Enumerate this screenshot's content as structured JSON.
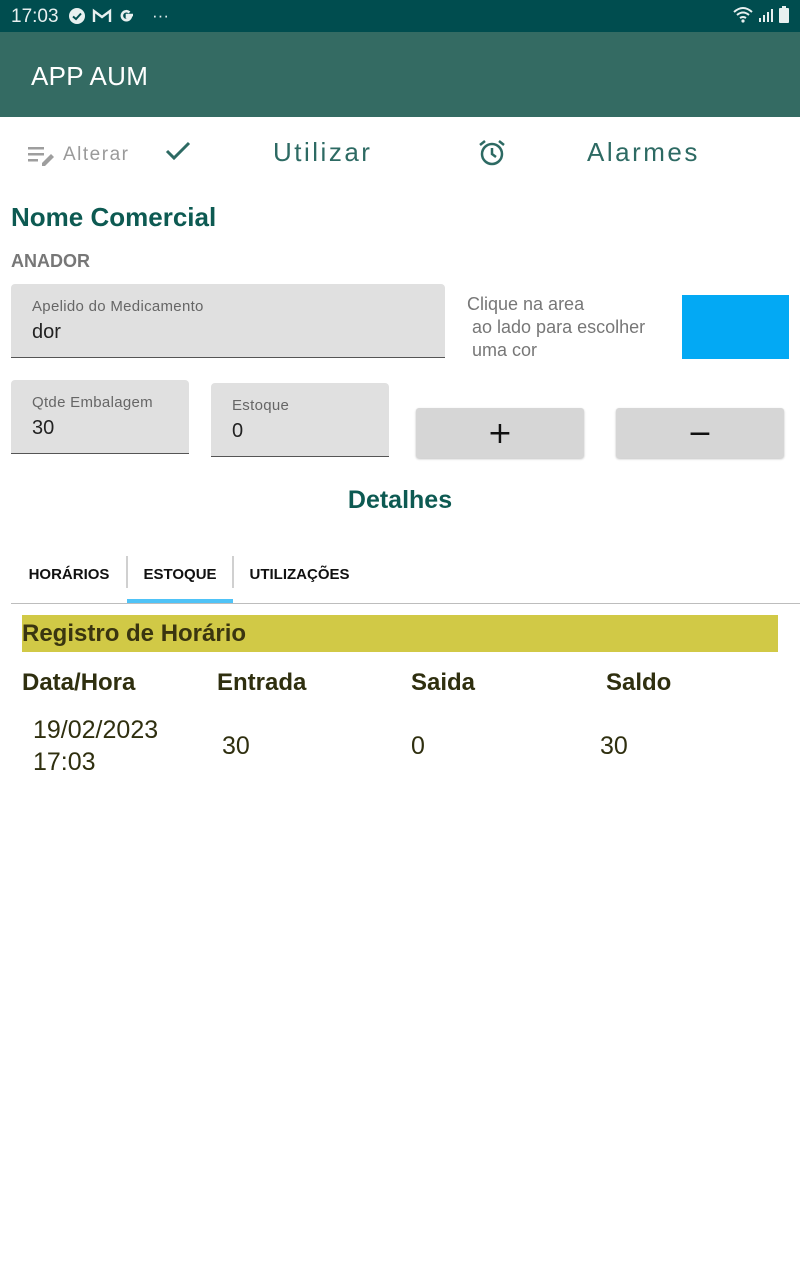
{
  "status_bar": {
    "time": "17:03",
    "icons_left": [
      "check-circle-icon",
      "gmail-icon",
      "google-icon",
      "more-dots-icon"
    ],
    "icons_right": [
      "wifi-icon",
      "signal-icon",
      "battery-icon"
    ],
    "more": "···"
  },
  "app_bar": {
    "title": "APP AUM"
  },
  "toolbar": {
    "alterar_label": "Alterar",
    "utilizar_label": "Utilizar",
    "alarmes_label": "Alarmes"
  },
  "medication": {
    "section_title": "Nome Comercial",
    "commercial_name": "ANADOR",
    "alias_field": {
      "label": "Apelido do Medicamento",
      "value": "dor"
    },
    "color_hint": "Clique na area\n ao lado para escolher\n uma cor",
    "color": "#03a9f4",
    "qtde_field": {
      "label": "Qtde Embalagem",
      "value": "30"
    },
    "estoque_field": {
      "label": "Estoque",
      "value": "0"
    },
    "plus_label": "+",
    "minus_label": "−"
  },
  "details": {
    "title": "Detalhes",
    "tabs": [
      {
        "label": "HORÁRIOS",
        "selected": false
      },
      {
        "label": "ESTOQUE",
        "selected": true
      },
      {
        "label": "UTILIZAÇÕES",
        "selected": false
      }
    ],
    "accent_color": "#4fc3f7"
  },
  "registro": {
    "title": "Registro de Horário",
    "banner_color": "#d1c946",
    "columns": [
      "Data/Hora",
      "Entrada",
      "Saida",
      "Saldo"
    ],
    "rows": [
      {
        "date": "19/02/2023",
        "time": "17:03",
        "entrada": "30",
        "saida": "0",
        "saldo": "30"
      }
    ]
  }
}
